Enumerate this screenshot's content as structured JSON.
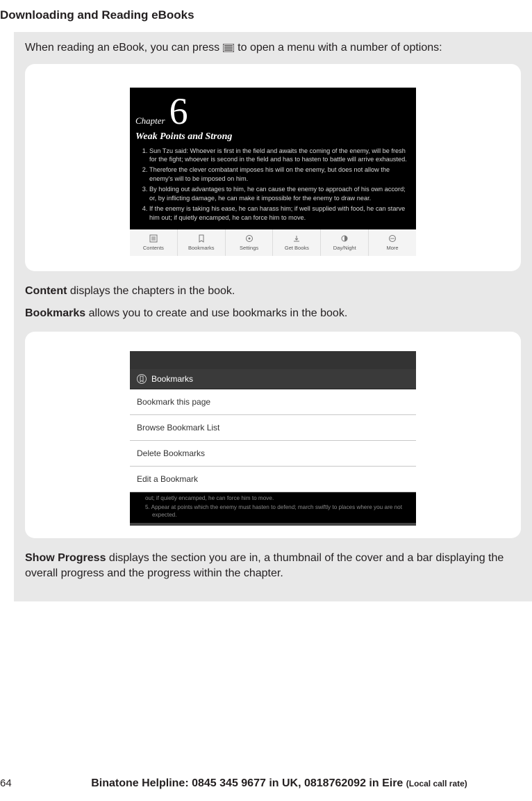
{
  "page_title": "Downloading and Reading eBooks",
  "intro": {
    "before_icon": "When reading an eBook, you can press",
    "after_icon": "to open a menu with a number of options:"
  },
  "ebook_reader": {
    "chapter_label": "Chapter",
    "chapter_number": "6",
    "chapter_title": "Weak Points and Strong",
    "list_items": [
      "Sun Tzu said: Whoever is first in the field and awaits the coming of the enemy, will be fresh for the fight; whoever is second in the field and has to hasten to battle will arrive exhausted.",
      "Therefore the clever combatant imposes his will on the enemy, but does not allow the enemy's will to be imposed on him.",
      "By holding out advantages to him, he can cause the enemy to approach of his own accord; or, by inflicting damage, he can make it impossible for the enemy to draw near.",
      "If the enemy is taking his ease, he can harass him; if well supplied with food, he can starve him out; if quietly encamped, he can force him to move."
    ],
    "toolbar": [
      "Contents",
      "Bookmarks",
      "Settings",
      "Get Books",
      "Day/Night",
      "More"
    ]
  },
  "desc_content": {
    "bold": "Content",
    "rest": " displays the chapters in the book."
  },
  "desc_bookmarks": {
    "bold": "Bookmarks",
    "rest": " allows you to create and use bookmarks in the book."
  },
  "bookmarks_header": "Bookmarks",
  "bookmarks_options": [
    "Bookmark this page",
    "Browse Bookmark List",
    "Delete Bookmarks",
    "Edit a Bookmark"
  ],
  "bookmarks_remain": {
    "line4_tail": "out; if quietly encamped, he can force him to move.",
    "line5": "5.   Appear at points which the enemy must hasten to defend; march swiftly to places where you are not expected."
  },
  "desc_show_progress": {
    "bold": "Show Progress",
    "rest": " displays the section you are in, a thumbnail of the cover and a bar displaying the overall progress and the progress within the chapter."
  },
  "footer": {
    "page_number": "64",
    "helpline_main": "Binatone Helpline: 0845 345 9677 in UK, 0818762092 in Eire ",
    "helpline_small": "(Local call rate)"
  }
}
